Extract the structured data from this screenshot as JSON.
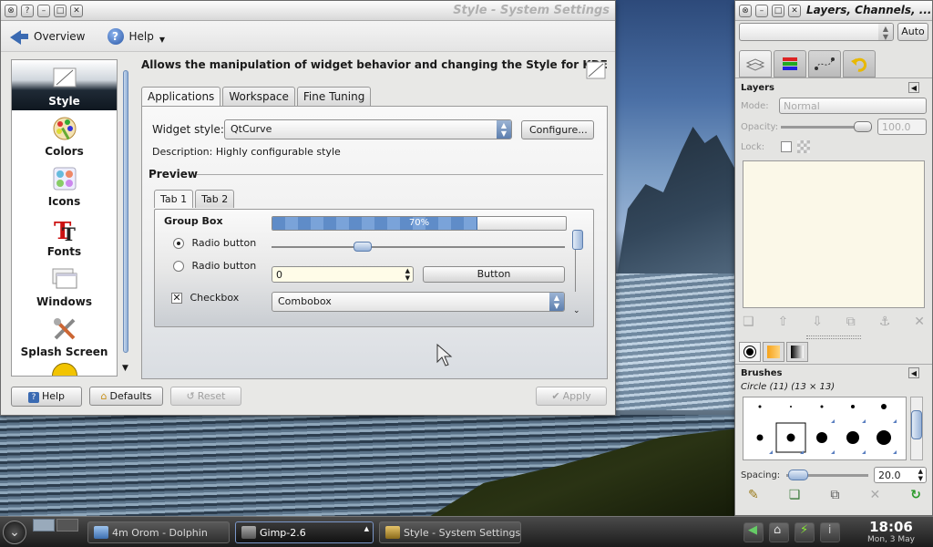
{
  "system_settings": {
    "title": "Style - System Settings",
    "toolbar": {
      "overview": "Overview",
      "help": "Help"
    },
    "sidebar": [
      {
        "label": "Style",
        "icon": "style-icon"
      },
      {
        "label": "Colors",
        "icon": "colors-icon"
      },
      {
        "label": "Icons",
        "icon": "icons-icon"
      },
      {
        "label": "Fonts",
        "icon": "fonts-icon"
      },
      {
        "label": "Windows",
        "icon": "windows-icon"
      },
      {
        "label": "Splash Screen",
        "icon": "splash-screen-icon"
      }
    ],
    "description": "Allows the manipulation of widget behavior and changing the Style for KDE",
    "tabs": [
      "Applications",
      "Workspace",
      "Fine Tuning"
    ],
    "widget_style_label": "Widget style:",
    "widget_style_value": "QtCurve",
    "configure_button": "Configure...",
    "style_description": "Description: Highly configurable style",
    "preview_label": "Preview",
    "preview": {
      "tabs": [
        "Tab 1",
        "Tab 2"
      ],
      "group_box": "Group Box",
      "radio1": "Radio button",
      "radio2": "Radio button",
      "checkbox": "Checkbox",
      "progress_text": "70%",
      "progress_value": 0.7,
      "spin_value": "0",
      "button": "Button",
      "combobox": "Combobox"
    },
    "bottom_buttons": {
      "help": "Help",
      "defaults": "Defaults",
      "reset": "Reset",
      "apply": "Apply"
    }
  },
  "gimp": {
    "title": "Layers, Channels, ...",
    "auto_button": "Auto",
    "layers_label": "Layers",
    "mode_label": "Mode:",
    "mode_value": "Normal",
    "opacity_label": "Opacity:",
    "opacity_value": "100.0",
    "lock_label": "Lock:",
    "brushes_label": "Brushes",
    "brush_name": "Circle (11) (13 × 13)",
    "spacing_label": "Spacing:",
    "spacing_value": "20.0"
  },
  "taskbar": {
    "tasks": [
      "4m Orom - Dolphin",
      "Gimp-2.6",
      "Style - System Settings"
    ],
    "clock_time": "18:06",
    "clock_date": "Mon, 3 May"
  }
}
